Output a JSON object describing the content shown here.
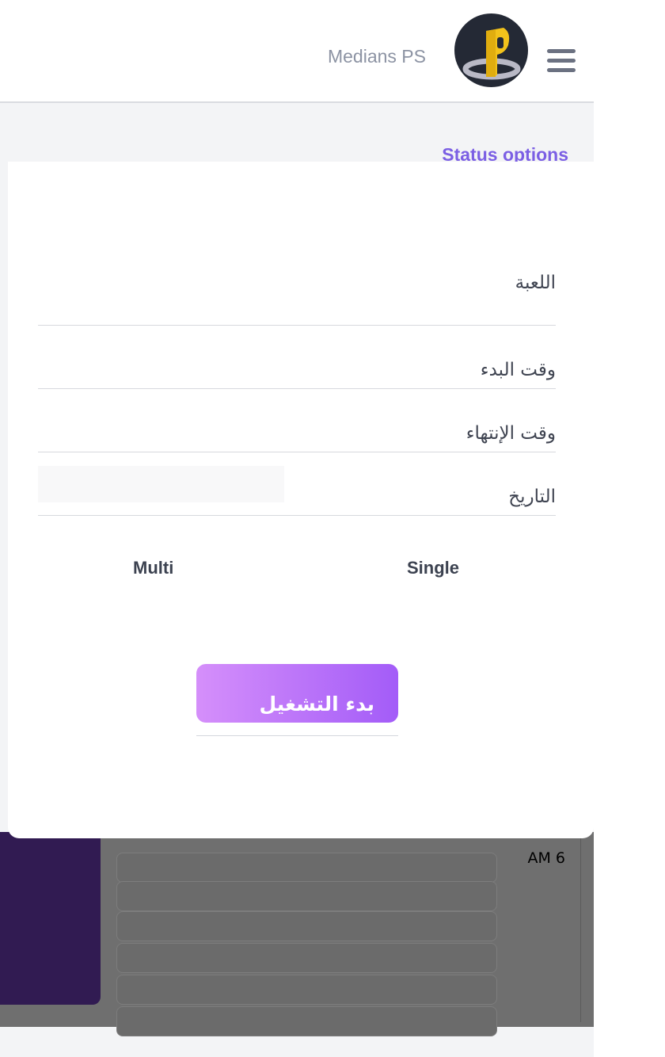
{
  "header": {
    "brand": "Medians PS",
    "menu_icon": "hamburger-menu-icon",
    "avatar_icon": "playstation-logo-icon"
  },
  "section": {
    "title": "Status options"
  },
  "modal": {
    "fields": {
      "game": "اللعبة",
      "start_time": "وقت البدء",
      "end_time": "وقت الإنتهاء",
      "date": "التاريخ"
    },
    "options": {
      "single": "Single",
      "multi": "Multi"
    },
    "start_button": "بدء التشغيل"
  },
  "background": {
    "time_label": "AM 6"
  },
  "colors": {
    "accent": "#7b5fe4",
    "button_start": "#d58ffa",
    "button_end": "#a35cf8",
    "sidebar_dark": "#311b52"
  }
}
